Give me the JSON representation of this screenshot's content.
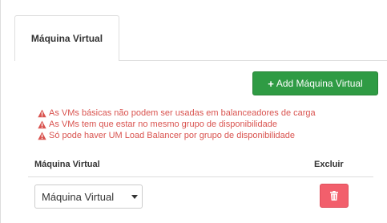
{
  "tabs": [
    {
      "label": "Máquina Virtual",
      "active": true
    }
  ],
  "toolbar": {
    "add_label": "Add Máquina Virtual",
    "add_icon": "plus-icon",
    "add_color": "#2f9b44"
  },
  "warnings": {
    "color": "#d9534f",
    "icon": "warning-icon",
    "items": [
      "As VMs básicas não podem ser usadas em balanceadores de carga",
      "As VMs tem que estar no mesmo grupo de disponibilidade",
      "Só pode haver UM Load Balancer por grupo de disponibilidade"
    ]
  },
  "table": {
    "headers": {
      "vm": "Máquina Virtual",
      "delete": "Excluir"
    },
    "rows": [
      {
        "vm_select_value": "Máquina Virtual",
        "delete_icon": "trash-icon",
        "delete_color": "#f25f6c"
      }
    ]
  }
}
